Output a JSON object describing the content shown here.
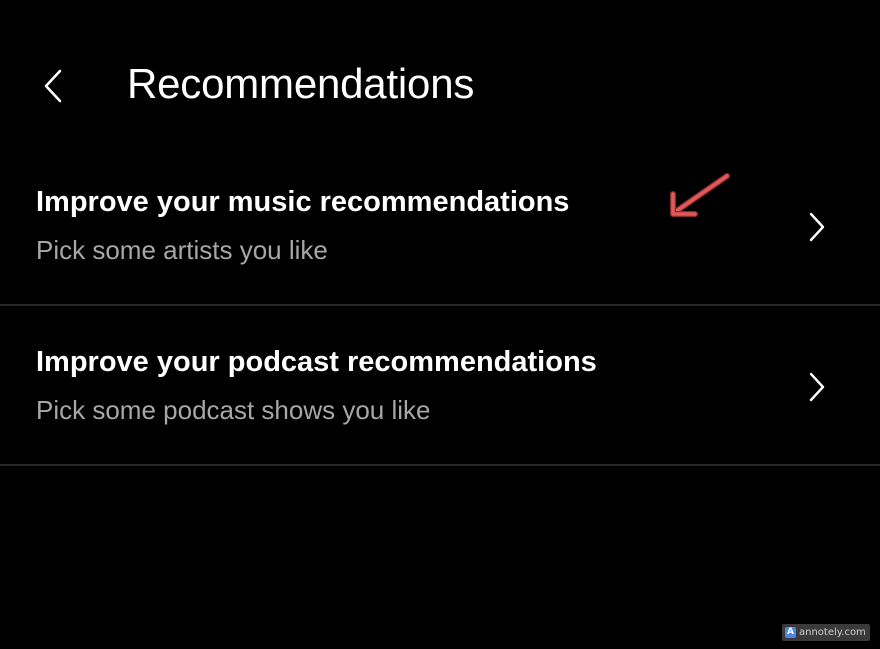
{
  "header": {
    "back_icon": "chevron-left-icon",
    "title": "Recommendations"
  },
  "rows": [
    {
      "title": "Improve your music recommendations",
      "subtitle": "Pick some artists you like",
      "icon": "chevron-right-icon"
    },
    {
      "title": "Improve your podcast recommendations",
      "subtitle": "Pick some podcast shows you like",
      "icon": "chevron-right-icon"
    }
  ],
  "annotation": {
    "icon": "arrow-annotation-icon",
    "color": "#e05a5a"
  },
  "watermark": {
    "logo_letter": "A",
    "text": "annotely.com"
  },
  "colors": {
    "background": "#000000",
    "text_primary": "#ffffff",
    "text_secondary": "#a7a7a7",
    "divider": "#282828"
  }
}
